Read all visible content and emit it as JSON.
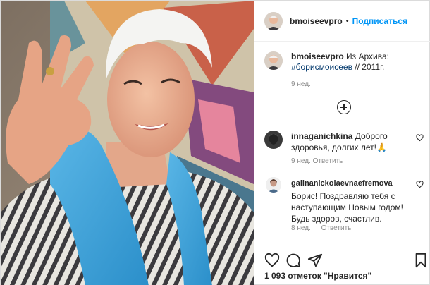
{
  "post": {
    "author": "bmoiseevpro",
    "separator": "•",
    "follow_label": "Подписаться"
  },
  "caption": {
    "author": "bmoiseevpro",
    "text": "Из Архива:",
    "hashtag": "#борисмоисеев",
    "suffix": "// 2011г.",
    "time": "9 нед."
  },
  "comments": [
    {
      "author": "innaganichkina",
      "text": "Доброго здоровья, долгих лет!🙏",
      "time": "9 нед.",
      "reply_label": "Ответить"
    },
    {
      "author": "galinanickolaevnaefremova",
      "text": "Борис! Поздравляю тебя с наступающим Новым годом! Будь здоров, счастлив.",
      "time": "8 нед.",
      "reply_label": "Ответить"
    }
  ],
  "likes_text": "1 093 отметок \"Нравится\"",
  "icons": {
    "like": "heart-icon",
    "comment": "comment-icon",
    "share": "share-icon",
    "save": "bookmark-icon",
    "more_comments": "plus-circle-icon"
  },
  "colors": {
    "link_blue": "#0095f6",
    "hashtag": "#00376b",
    "muted": "#8e8e8e",
    "text": "#262626"
  }
}
